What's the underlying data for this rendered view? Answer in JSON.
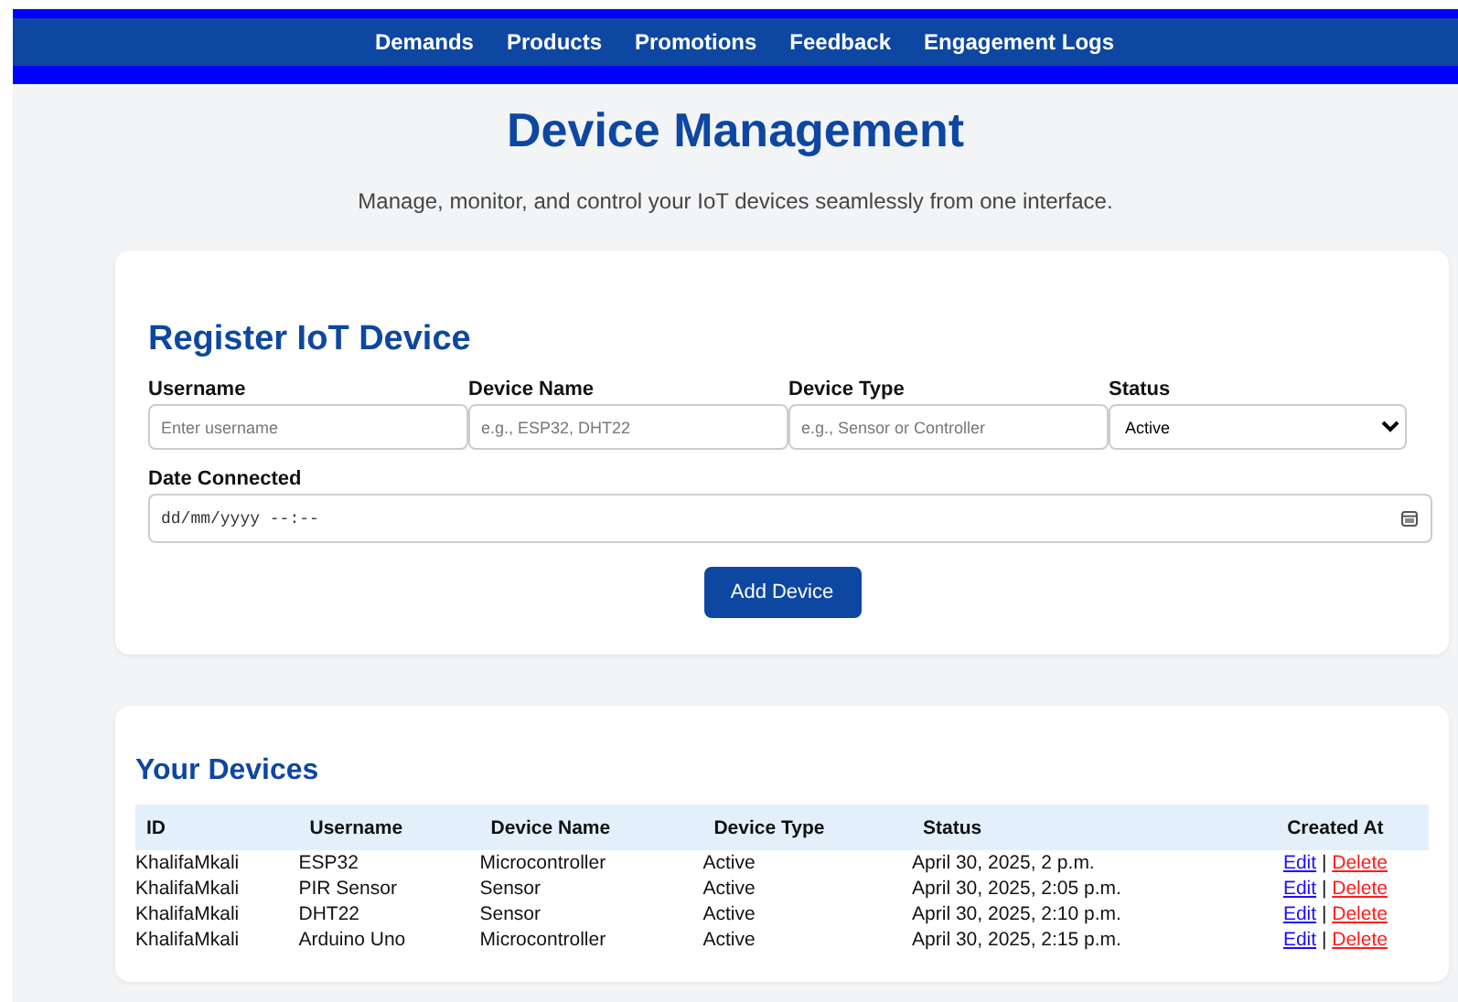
{
  "nav": {
    "items": [
      {
        "label": "Demands"
      },
      {
        "label": "Products"
      },
      {
        "label": "Promotions"
      },
      {
        "label": "Feedback"
      },
      {
        "label": "Engagement Logs"
      }
    ]
  },
  "header": {
    "title": "Device Management",
    "subtitle": "Manage, monitor, and control your IoT devices seamlessly from one interface."
  },
  "form": {
    "title": "Register IoT Device",
    "fields": [
      {
        "kind": "text",
        "label": "Username",
        "placeholder": "Enter username"
      },
      {
        "kind": "text",
        "label": "Device Name",
        "placeholder": "e.g., ESP32, DHT22"
      },
      {
        "kind": "text",
        "label": "Device Type",
        "placeholder": "e.g., Sensor or Controller"
      },
      {
        "kind": "select",
        "label": "Status",
        "value": "Active"
      }
    ],
    "date": {
      "label": "Date Connected",
      "placeholder": "dd/mm/yyyy --:--"
    },
    "button": "Add Device"
  },
  "devices": {
    "title": "Your Devices",
    "columns": [
      "ID",
      "Username",
      "Device Name",
      "Device Type",
      "Status",
      "Created At"
    ],
    "rows": [
      {
        "cells": [
          "KhalifaMkali",
          "ESP32",
          "Microcontroller",
          "Active",
          "April 30, 2025, 2 p.m."
        ],
        "edit": "Edit",
        "separator": "|",
        "delete": "Delete"
      },
      {
        "cells": [
          "KhalifaMkali",
          "PIR Sensor",
          "Sensor",
          "Active",
          "April 30, 2025, 2:05 p.m."
        ],
        "edit": "Edit",
        "separator": "|",
        "delete": "Delete"
      },
      {
        "cells": [
          "KhalifaMkali",
          "DHT22",
          "Sensor",
          "Active",
          "April 30, 2025, 2:10 p.m."
        ],
        "edit": "Edit",
        "separator": "|",
        "delete": "Delete"
      },
      {
        "cells": [
          "KhalifaMkali",
          "Arduino Uno",
          "Microcontroller",
          "Active",
          "April 30, 2025, 2:15 p.m."
        ],
        "edit": "Edit",
        "separator": "|",
        "delete": "Delete"
      }
    ]
  }
}
